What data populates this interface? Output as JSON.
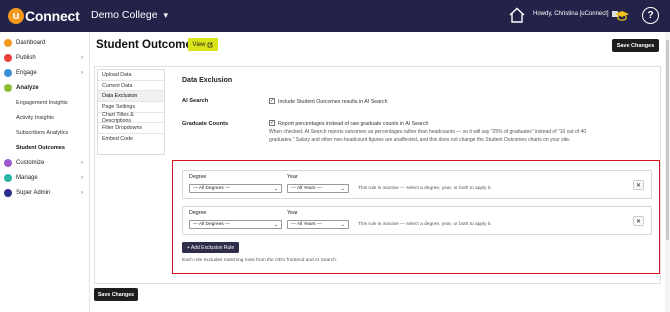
{
  "app": {
    "logo_letter": "u",
    "logo_text": "Connect",
    "college": "Demo College",
    "user": "Howdy, Christina [uConnect]",
    "help": "?"
  },
  "sidebar": {
    "items": [
      {
        "label": "Dashboard",
        "icon": "dashboard-icon",
        "color": "#f39a1e"
      },
      {
        "label": "Publish",
        "icon": "publish-icon",
        "color": "#e83e3e"
      },
      {
        "label": "Engage",
        "icon": "engage-icon",
        "color": "#3a8ed8"
      },
      {
        "label": "Analyze",
        "icon": "analyze-icon",
        "color": "#8bbf3a"
      },
      {
        "label": "Customize",
        "icon": "customize-icon",
        "color": "#9a59c9"
      },
      {
        "label": "Manage",
        "icon": "manage-icon",
        "color": "#2db3a6"
      },
      {
        "label": "Super Admin",
        "icon": "super-admin-icon",
        "color": "#2d2d8a"
      }
    ],
    "analyze_sub": [
      "Engagement Insights",
      "Activity Insights",
      "Subscribers Analytics",
      "Student Outcomes"
    ],
    "arrow": "›"
  },
  "header": {
    "title": "Student Outcomes",
    "view": "View",
    "save": "Save Changes"
  },
  "tabs": [
    "Upload Data",
    "Current Data",
    "Data Exclusion",
    "Page Settings",
    "Chart Titles & Descriptions",
    "Filter Dropdowns",
    "Embed Code"
  ],
  "exclusion": {
    "title": "Data Exclusion",
    "ai_label": "AI Search",
    "ai_text": "Include Student Outcomes results in AI Search",
    "gc_label": "Graduate Counts",
    "gc_text": "Report percentages instead of raw graduate counts in AI Search",
    "gc_note": "When checked, AI Search reports outcomes as percentages rather than headcounts — so it will say \"25% of graduates\" instead of \"10 out of 40 graduates.\" Salary and other non-headcount figures are unaffected, and this does not change the Student Outcomes charts on your site."
  },
  "rules": [
    {
      "degree_label": "Degree",
      "degree_value": "— All Degrees —",
      "year_label": "Year",
      "year_value": "— All Years —",
      "status": "This rule is inactive — select a degree, year, or both to apply it.",
      "close": "✕"
    },
    {
      "degree_label": "Degree",
      "degree_value": "— All Degrees —",
      "year_label": "Year",
      "year_value": "— All Years —",
      "status": "This rule is inactive — select a degree, year, or both to apply it.",
      "close": "✕"
    }
  ],
  "add_rule": "+ Add Exclusion Rule",
  "help_text": "Each rule excludes matching rows from the ODV frontend and AI Search.",
  "save_bottom": "Save Changes",
  "colors": {
    "topbar": "#23234a",
    "accent_view": "#d8e31a",
    "highlight": "#d9141e"
  }
}
